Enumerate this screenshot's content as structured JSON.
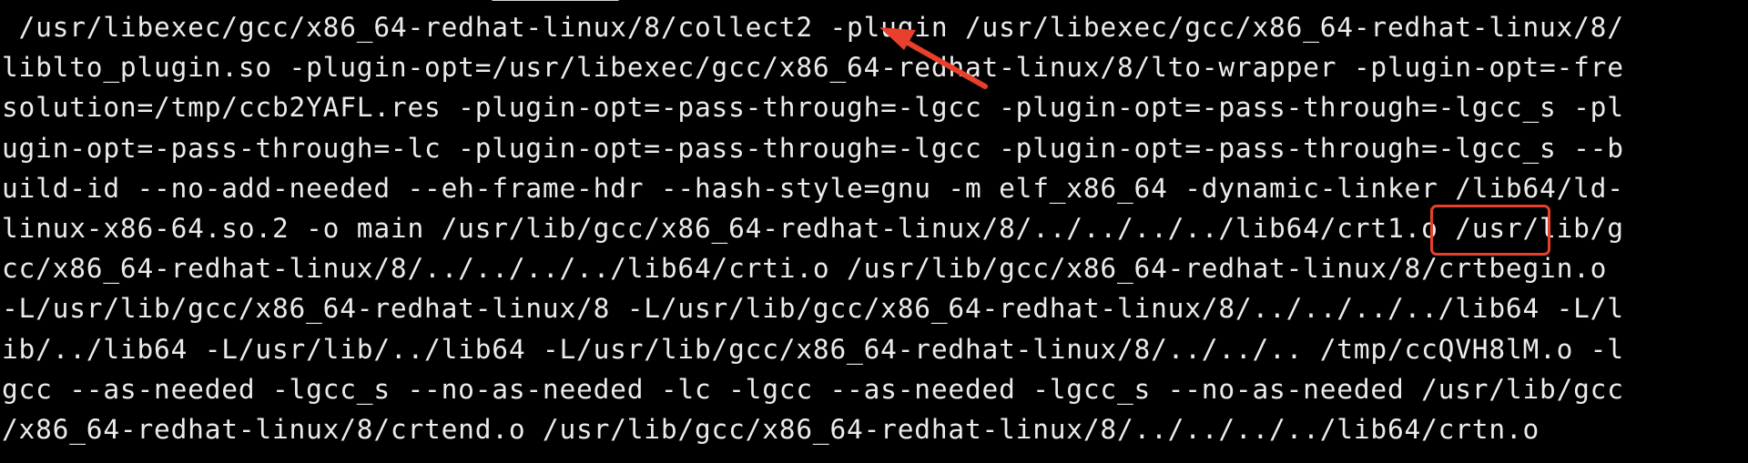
{
  "terminal": {
    "lines": [
      " /usr/libexec/gcc/x86_64-redhat-linux/8/collect2 -plugin /usr/libexec/gcc/x86_64-redhat-linux/8/",
      "liblto_plugin.so -plugin-opt=/usr/libexec/gcc/x86_64-redhat-linux/8/lto-wrapper -plugin-opt=-fre",
      "solution=/tmp/ccb2YAFL.res -plugin-opt=-pass-through=-lgcc -plugin-opt=-pass-through=-lgcc_s -pl",
      "ugin-opt=-pass-through=-lc -plugin-opt=-pass-through=-lgcc -plugin-opt=-pass-through=-lgcc_s --b",
      "uild-id --no-add-needed --eh-frame-hdr --hash-style=gnu -m elf_x86_64 -dynamic-linker /lib64/ld-",
      "linux-x86-64.so.2 -o main /usr/lib/gcc/x86_64-redhat-linux/8/../../../../lib64/crt1.o /usr/lib/g",
      "cc/x86_64-redhat-linux/8/../../../../lib64/crti.o /usr/lib/gcc/x86_64-redhat-linux/8/crtbegin.o",
      "-L/usr/lib/gcc/x86_64-redhat-linux/8 -L/usr/lib/gcc/x86_64-redhat-linux/8/../../../../lib64 -L/l",
      "ib/../lib64 -L/usr/lib/../lib64 -L/usr/lib/gcc/x86_64-redhat-linux/8/../../.. /tmp/ccQVH8lM.o -l",
      "gcc --as-needed -lgcc_s --no-as-needed -lc -lgcc --as-needed -lgcc_s --no-as-needed /usr/lib/gcc",
      "/x86_64-redhat-linux/8/crtend.o /usr/lib/gcc/x86_64-redhat-linux/8/../../../../lib64/crtn.o"
    ]
  },
  "annotations": {
    "highlight_color": "#e8402c",
    "arrow_icon": "arrow-pointing-to-collect2-icon",
    "box_icon": "highlight-box-crt1"
  },
  "colors": {
    "background": "#000000",
    "text": "#ececec"
  }
}
